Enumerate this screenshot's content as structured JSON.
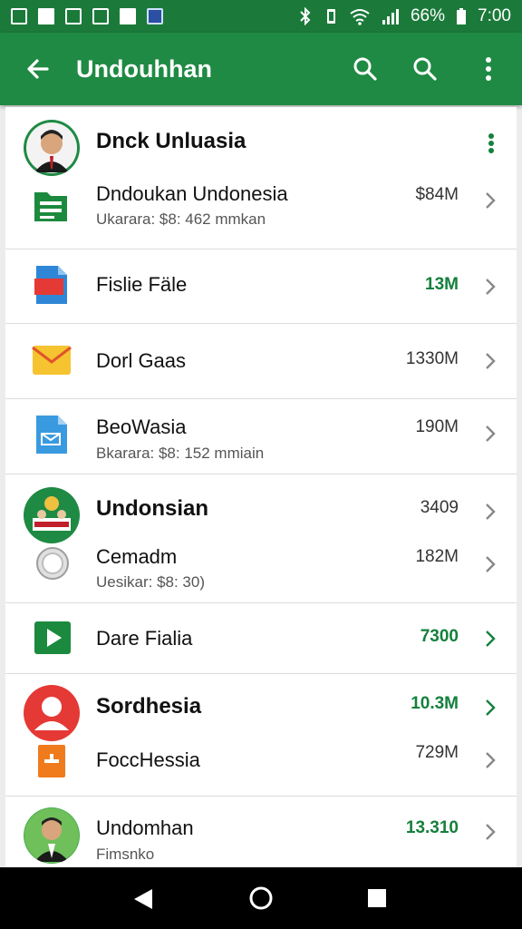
{
  "status_bar": {
    "battery": "66%",
    "time": "7:00",
    "left_icons": [
      "gallery-icon",
      "image-icon",
      "photo-icon",
      "document-icon",
      "download-icon",
      "calendar-icon"
    ],
    "right_icons": [
      "bluetooth-icon",
      "vibrate-icon",
      "wifi-icon",
      "signal-icon",
      "battery-icon"
    ]
  },
  "app_bar": {
    "title": "Undouhhan",
    "actions": [
      "search-icon",
      "search-icon",
      "more-vert-icon"
    ]
  },
  "groups": [
    {
      "title": "Dnck Unluasia",
      "items": [
        {
          "icon": "sheet-icon",
          "name": "Dndoukan Undonesia",
          "sub": "Ukarara: $8: 462 mmkan",
          "size": "$84M",
          "size_green": false
        }
      ]
    },
    {
      "title": "",
      "items": [
        {
          "icon": "doc-blue-red-icon",
          "name": "Fislie Fäle",
          "sub": "",
          "size": "13M",
          "size_green": true
        },
        {
          "icon": "mail-icon",
          "name": "Dorl Gaas",
          "sub": "",
          "size": "1330M",
          "size_green": false
        },
        {
          "icon": "doc-blue-icon",
          "name": "BeoWasia",
          "sub": "Bkarara: $8: 152 mmiain",
          "size": "190M",
          "size_green": false
        }
      ]
    },
    {
      "title": "Undonsian",
      "title_size": "3409",
      "items": [
        {
          "icon": "radio-icon",
          "name": "Cemadm",
          "sub": "Uesikar: $8: 30)",
          "size": "182M",
          "size_green": false
        },
        {
          "icon": "play-icon",
          "name": "Dare Fialia",
          "sub": "",
          "size": "7300",
          "size_green": true
        }
      ]
    },
    {
      "title": "Sordhesia",
      "title_size": "10.3M",
      "items": [
        {
          "icon": "orange-doc-icon",
          "name": "FoccHessia",
          "sub": "",
          "size": "729M",
          "size_green": false
        }
      ]
    },
    {
      "title": "",
      "items": [
        {
          "icon": "avatar",
          "name": "Undomhan",
          "sub": "Fimsnko",
          "size": "13.310",
          "size_green": true
        }
      ]
    }
  ],
  "nav_bar": [
    "back-triangle-icon",
    "home-circle-icon",
    "recents-square-icon"
  ],
  "colors": {
    "primary": "#1f8a43",
    "primary_dark": "#1b7a3a",
    "accent_green": "#15803d"
  }
}
